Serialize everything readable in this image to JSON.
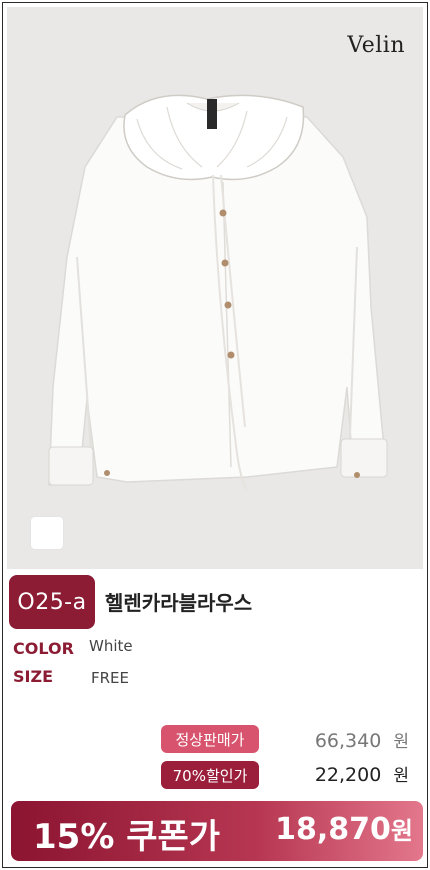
{
  "brand": "Velin",
  "product": {
    "code": "O25-a",
    "name": "헬렌카라블라우스",
    "swatch_color": "#ffffff"
  },
  "specs": {
    "color_label": "COLOR",
    "color_value": "White",
    "size_label": "SIZE",
    "size_value": "FREE"
  },
  "pricing": {
    "regular_label": "정상판매가",
    "regular_price": "66,340",
    "regular_unit": "원",
    "discount_label": "70%할인가",
    "discount_price": "22,200",
    "discount_unit": "원"
  },
  "coupon": {
    "label": "15% 쿠폰가",
    "price": "18,870",
    "unit": "원"
  },
  "colors": {
    "accent": "#8c1c34",
    "pill_pink": "#d8546e",
    "pill_dark": "#9b1f3b"
  }
}
